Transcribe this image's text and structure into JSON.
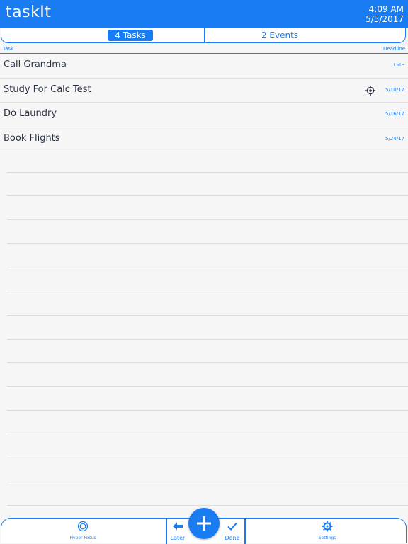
{
  "app": {
    "title": "taskIt"
  },
  "status": {
    "time": "4:09 AM",
    "date": "5/5/2017"
  },
  "segments": {
    "tasks": "4 Tasks",
    "events": "2 Events"
  },
  "columns": {
    "task": "Task",
    "deadline": "Deadline"
  },
  "tasks": [
    {
      "title": "Call Grandma",
      "deadline": "Late",
      "hyper_focus": false
    },
    {
      "title": "Study For Calc Test",
      "deadline": "5/10/17",
      "hyper_focus": true
    },
    {
      "title": "Do Laundry",
      "deadline": "5/16/17",
      "hyper_focus": false
    },
    {
      "title": "Book Flights",
      "deadline": "5/24/17",
      "hyper_focus": false
    }
  ],
  "footer": {
    "hyper_focus": "Hyper Focus",
    "later": "Later",
    "done": "Done",
    "settings": "Settings"
  },
  "colors": {
    "accent": "#1a7cf2",
    "background": "#f6f6f6",
    "text": "#2b3244"
  },
  "icons": [
    "hyper-focus-icon",
    "later-arrow-icon",
    "add-icon",
    "done-check-icon",
    "gear-icon",
    "target-icon"
  ]
}
